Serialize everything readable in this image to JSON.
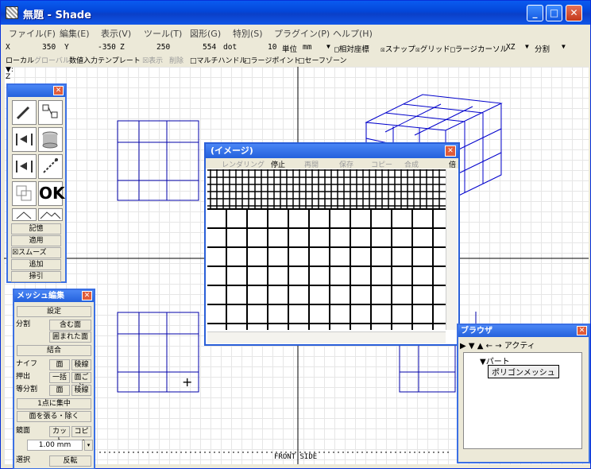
{
  "window": {
    "title": "無題 - Shade"
  },
  "menu": [
    "ファイル(F)",
    "編集(E)",
    "表示(V)",
    "ツール(T)",
    "図形(G)",
    "特別(S)",
    "プラグイン(P)",
    "ヘルプ(H)"
  ],
  "coords": {
    "x_label": "X",
    "x_value": "350",
    "y_label": "Y",
    "y_value": "-350",
    "z_label": "Z",
    "z_value": "250",
    "dot_value": "554",
    "dot_unit": "dot",
    "grid_value": "10",
    "unit_label": "単位",
    "unit_value": "mm",
    "relative": "□相対座標",
    "snap": "☒スナップ",
    "grid": "☒グリッド",
    "large_cursor": "□ラージカーソル",
    "plane": "XZ",
    "split": "分割"
  },
  "options": {
    "local": "ローカル",
    "global": "グローバル",
    "numeric_template": "数値入力テンプレート",
    "show": "☒表示",
    "delete": "削除",
    "multi_handle": "□マルチハンドル",
    "large_point": "□ラージポイント",
    "safe_zone": "□セーフゾーン"
  },
  "viewport": {
    "axis_label": "▼:\nZ",
    "view_label": "FRONT SIDE"
  },
  "tools": {
    "ok": "OK",
    "memory": "記憶",
    "apply": "適用",
    "smooth": "☒スムーズ",
    "add": "追加",
    "pull": "掃引"
  },
  "mesh_palette": {
    "title": "メッシュ編集",
    "settings": "設定",
    "divide": "分割",
    "include_face": "含む面",
    "enclosed_face": "囲まれた面",
    "join": "結合",
    "knife": "ナイフ",
    "face": "面",
    "edge": "稜線",
    "extrude": "押出",
    "all_at_once": "一括",
    "per_face": "面ごと",
    "equal_divide": "等分割",
    "face2": "面",
    "edge2": "稜線",
    "point_concentrate": "1点に集中",
    "stretch_face": "面を張る・除く",
    "mirror": "鏡面",
    "cut": "カット",
    "copy": "コピー",
    "value": "1.00 mm",
    "bottom_left": "選択",
    "bottom_right": "反転"
  },
  "image_window": {
    "title": "(イメージ)",
    "render": "レンダリング",
    "stop": "停止",
    "resume": "再開",
    "save": "保存",
    "copy": "コピー",
    "composite": "合成",
    "scale": "倍"
  },
  "browser": {
    "title": "ブラウザ",
    "active": "アクティ",
    "part": "▼パート",
    "polygon_mesh": "ポリゴンメッシュ"
  }
}
